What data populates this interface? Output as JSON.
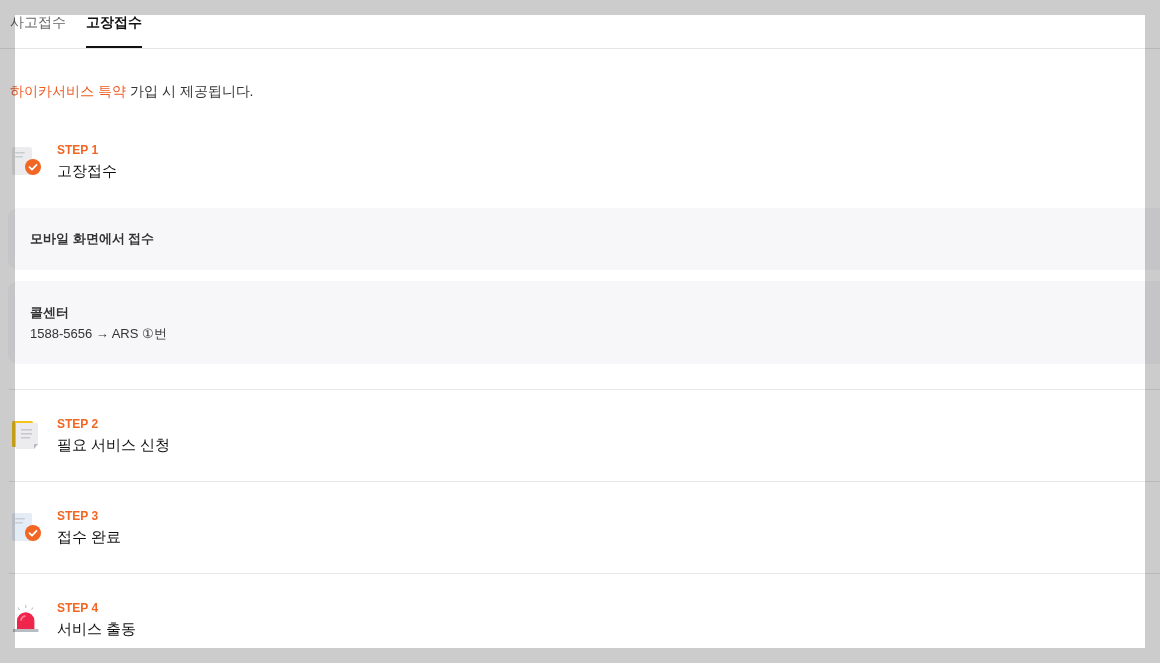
{
  "tabs": [
    {
      "label": "사고접수",
      "selected": false
    },
    {
      "label": "고장접수",
      "selected": true
    }
  ],
  "notice": {
    "highlight": "하이카서비스 특약",
    "text": " 가입 시 제공됩니다."
  },
  "steps": [
    {
      "step": "STEP 1",
      "title": "고장접수",
      "methods": [
        {
          "title": "모바일 화면에서 접수"
        },
        {
          "title": "콜센터",
          "detail": "1588-5656 → ARS ①번"
        }
      ]
    },
    {
      "step": "STEP 2",
      "title": "필요 서비스 신청"
    },
    {
      "step": "STEP 3",
      "title": "접수 완료"
    },
    {
      "step": "STEP 4",
      "title": "서비스 출동"
    }
  ]
}
